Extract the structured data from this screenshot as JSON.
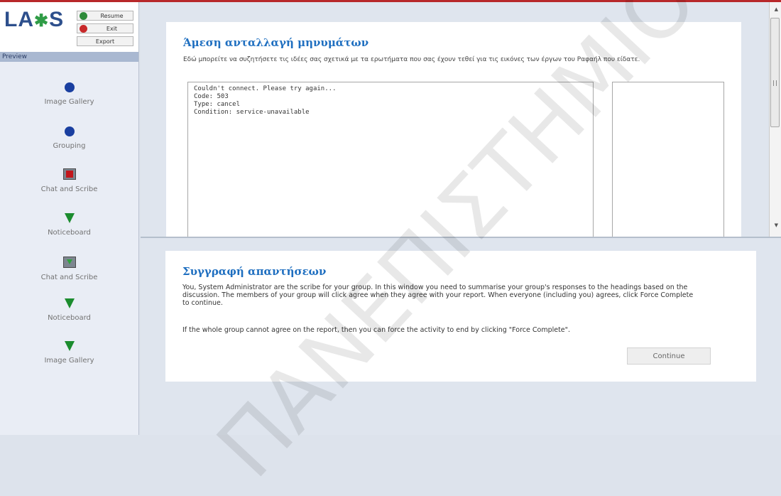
{
  "app": {
    "logo_text": "LAMS",
    "resume_label": "Resume",
    "exit_label": "Exit",
    "export_label": "Export",
    "preview_label": "Preview"
  },
  "sequence": [
    {
      "label": "Image Gallery",
      "icon": "blue-circle-icon"
    },
    {
      "label": "Grouping",
      "icon": "blue-circle-icon"
    },
    {
      "label": "Chat and Scribe",
      "icon": "red-square-icon"
    },
    {
      "label": "Noticeboard",
      "icon": "green-triangle-icon"
    },
    {
      "label": "Chat and Scribe",
      "icon": "green-square-icon"
    },
    {
      "label": "Noticeboard",
      "icon": "green-triangle-icon"
    },
    {
      "label": "Image Gallery",
      "icon": "green-triangle-icon"
    }
  ],
  "chat": {
    "title": "Άμεση ανταλλαγή μηνυμάτων",
    "intro": "Εδώ μπορείτε να συζητήσετε τις ιδέες σας σχετικά με τα ερωτήματα που σας έχουν τεθεί για τις εικόνες των έργων του Ραφαήλ που είδατε.",
    "messages": [
      "Couldn't connect. Please try again...",
      "Code: 503",
      "Type: cancel",
      "Condition: service-unavailable"
    ]
  },
  "scribe": {
    "title": "Συγγραφή απαντήσεων",
    "paragraph1": "You, System Administrator are the scribe for your group. In this window you need to summarise your group's responses to the headings based on the discussion. The members of your group will click agree when they agree with your report. When everyone (including you) agrees, click Force Complete to continue.",
    "paragraph2": "If the whole group cannot agree on the report, then you can force the activity to end by clicking \"Force Complete\".",
    "continue_label": "Continue"
  },
  "watermark": "ΠΑΝΕΠΙΣΤΗΜΙΟ ΠΕΙΡΑΙΩΣ",
  "colors": {
    "accent_red": "#b8282a",
    "title_blue": "#1f6fc0",
    "logo_blue": "#2d4f8c",
    "resume_green": "#2e8b3a",
    "exit_red": "#c8282a"
  }
}
